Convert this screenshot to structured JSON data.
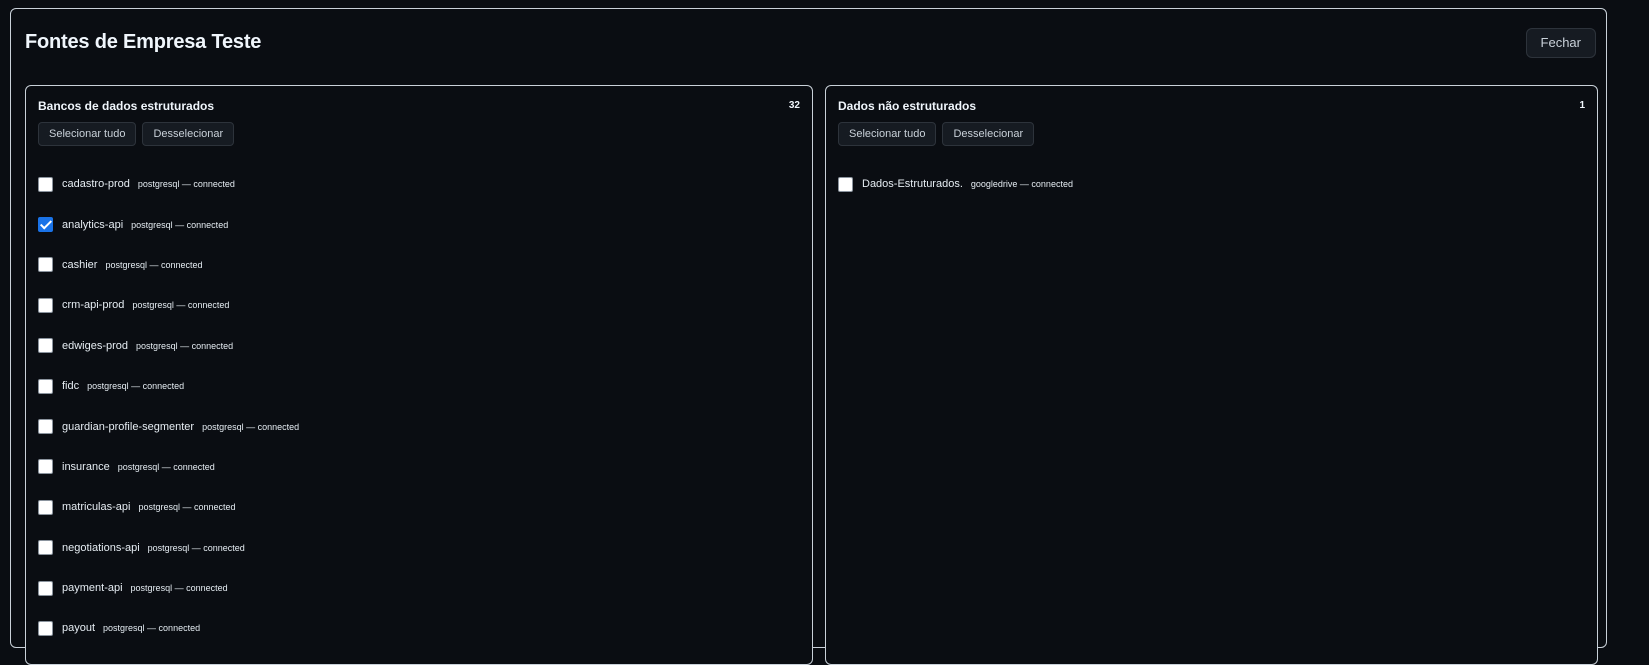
{
  "modal": {
    "title": "Fontes de Empresa Teste",
    "close_label": "Fechar"
  },
  "structured": {
    "title": "Bancos de dados estruturados",
    "count": "32",
    "select_all_label": "Selecionar tudo",
    "deselect_label": "Desselecionar",
    "items": [
      {
        "name": "cadastro-prod",
        "meta": "postgresql — connected",
        "checked": false
      },
      {
        "name": "analytics-api",
        "meta": "postgresql — connected",
        "checked": true
      },
      {
        "name": "cashier",
        "meta": "postgresql — connected",
        "checked": false
      },
      {
        "name": "crm-api-prod",
        "meta": "postgresql — connected",
        "checked": false
      },
      {
        "name": "edwiges-prod",
        "meta": "postgresql — connected",
        "checked": false
      },
      {
        "name": "fidc",
        "meta": "postgresql — connected",
        "checked": false
      },
      {
        "name": "guardian-profile-segmenter",
        "meta": "postgresql — connected",
        "checked": false
      },
      {
        "name": "insurance",
        "meta": "postgresql — connected",
        "checked": false
      },
      {
        "name": "matriculas-api",
        "meta": "postgresql — connected",
        "checked": false
      },
      {
        "name": "negotiations-api",
        "meta": "postgresql — connected",
        "checked": false
      },
      {
        "name": "payment-api",
        "meta": "postgresql — connected",
        "checked": false
      },
      {
        "name": "payout",
        "meta": "postgresql — connected",
        "checked": false
      }
    ]
  },
  "unstructured": {
    "title": "Dados não estruturados",
    "count": "1",
    "select_all_label": "Selecionar tudo",
    "deselect_label": "Desselecionar",
    "items": [
      {
        "name": "Dados-Estruturados.",
        "meta": "googledrive — connected",
        "checked": false
      }
    ]
  },
  "colors": {
    "background": "#0a0d12",
    "border": "#c9d1d9",
    "checked_accent": "#1a73e8"
  }
}
